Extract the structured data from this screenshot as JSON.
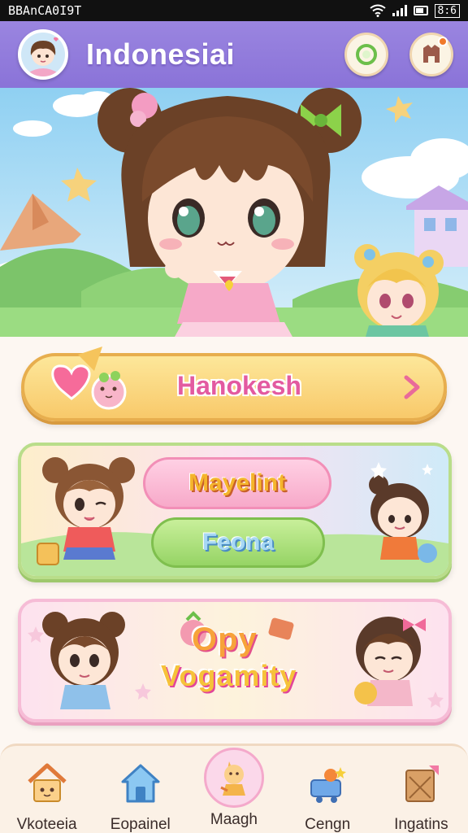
{
  "status_bar": {
    "carrier": "BBAnCA0I9T",
    "time": "8:6"
  },
  "header": {
    "title": "Indonesiai"
  },
  "banner_button": {
    "label": "Hanokesh"
  },
  "feature_card": {
    "primary_label": "Mayelint",
    "secondary_label": "Feona"
  },
  "event_card": {
    "line1": "Opy",
    "line2": "Vogamity"
  },
  "bottom_nav": [
    {
      "label": "Vkoteeia",
      "icon": "house-icon",
      "active": false
    },
    {
      "label": "Eopainel",
      "icon": "home-icon",
      "active": false
    },
    {
      "label": "Maagh",
      "icon": "character-icon",
      "active": true
    },
    {
      "label": "Cengn",
      "icon": "cart-icon",
      "active": false
    },
    {
      "label": "Ingatins",
      "icon": "scroll-icon",
      "active": false
    }
  ],
  "colors": {
    "header": "#8a73d8",
    "accent_pink": "#e35aa0",
    "gold": "#f8c96a",
    "green": "#96d465"
  }
}
